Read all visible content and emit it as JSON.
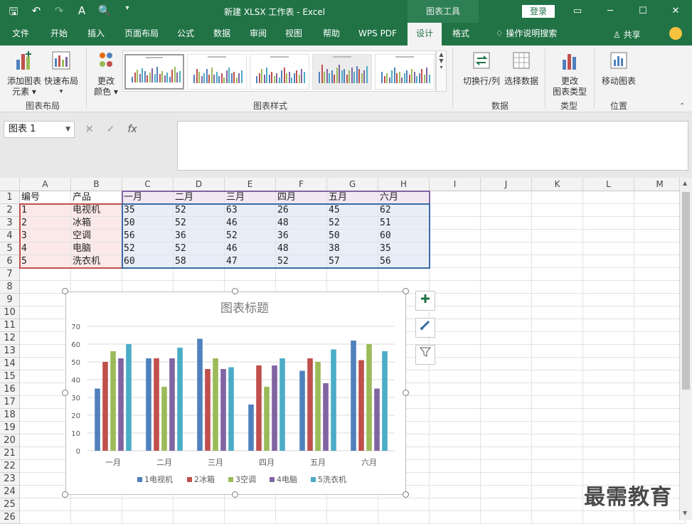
{
  "titlebar": {
    "title": "新建 XLSX 工作表  -  Excel",
    "context_tab": "图表工具",
    "login": "登录",
    "qat": [
      "save-icon",
      "undo-icon",
      "redo-icon",
      "format-painter-icon",
      "print-preview-icon",
      "customize-icon"
    ]
  },
  "tabs": [
    "文件",
    "开始",
    "插入",
    "页面布局",
    "公式",
    "数据",
    "审阅",
    "视图",
    "帮助",
    "WPS PDF",
    "设计",
    "格式"
  ],
  "active_tab": "设计",
  "tell_me": "操作说明搜索",
  "share": "共享",
  "ribbon": {
    "add_element": "添加图表\n元素",
    "quick_layout": "快速布局",
    "change_colors": "更改\n颜色",
    "group_layout": "图表布局",
    "group_styles": "图表样式",
    "switch_row_col": "切换行/列",
    "select_data": "选择数据",
    "group_data": "数据",
    "change_type": "更改\n图表类型",
    "group_type": "类型",
    "move_chart": "移动图表",
    "group_location": "位置"
  },
  "formula_bar": {
    "name_box": "图表 1",
    "fx": "fx",
    "value": ""
  },
  "columns": [
    "A",
    "B",
    "C",
    "D",
    "E",
    "F",
    "G",
    "H",
    "I",
    "J",
    "K",
    "L",
    "M"
  ],
  "rows": [
    "1",
    "2",
    "3",
    "4",
    "5",
    "6",
    "7",
    "8",
    "9",
    "10",
    "11",
    "12",
    "13",
    "14",
    "15",
    "16",
    "17",
    "18",
    "19",
    "20",
    "21",
    "22",
    "23",
    "24",
    "25",
    "26"
  ],
  "sheet": [
    [
      "编号",
      "产品",
      "一月",
      "二月",
      "三月",
      "四月",
      "五月",
      "六月"
    ],
    [
      "1",
      "电视机",
      "35",
      "52",
      "63",
      "26",
      "45",
      "62"
    ],
    [
      "2",
      "冰箱",
      "50",
      "52",
      "46",
      "48",
      "52",
      "51"
    ],
    [
      "3",
      "空调",
      "56",
      "36",
      "52",
      "36",
      "50",
      "60"
    ],
    [
      "4",
      "电脑",
      "52",
      "52",
      "46",
      "48",
      "38",
      "35"
    ],
    [
      "5",
      "洗衣机",
      "60",
      "58",
      "47",
      "52",
      "57",
      "56"
    ]
  ],
  "chart_data": {
    "type": "bar",
    "title": "图表标题",
    "categories": [
      "一月",
      "二月",
      "三月",
      "四月",
      "五月",
      "六月"
    ],
    "ylim": [
      0,
      70
    ],
    "yticks": [
      "0",
      "10",
      "20",
      "30",
      "40",
      "50",
      "60",
      "70"
    ],
    "grid": true,
    "legend": "bottom",
    "series": [
      {
        "name": "1电视机",
        "color": "#4f81bd",
        "values": [
          35,
          52,
          63,
          26,
          45,
          62
        ]
      },
      {
        "name": "2冰箱",
        "color": "#c0504d",
        "values": [
          50,
          52,
          46,
          48,
          52,
          51
        ]
      },
      {
        "name": "3空调",
        "color": "#9bbb59",
        "values": [
          56,
          36,
          52,
          36,
          50,
          60
        ]
      },
      {
        "name": "4电脑",
        "color": "#8064a2",
        "values": [
          52,
          52,
          46,
          48,
          38,
          35
        ]
      },
      {
        "name": "5洗衣机",
        "color": "#4bacc6",
        "values": [
          60,
          58,
          47,
          52,
          57,
          56
        ]
      }
    ]
  },
  "watermark": "最需教育"
}
